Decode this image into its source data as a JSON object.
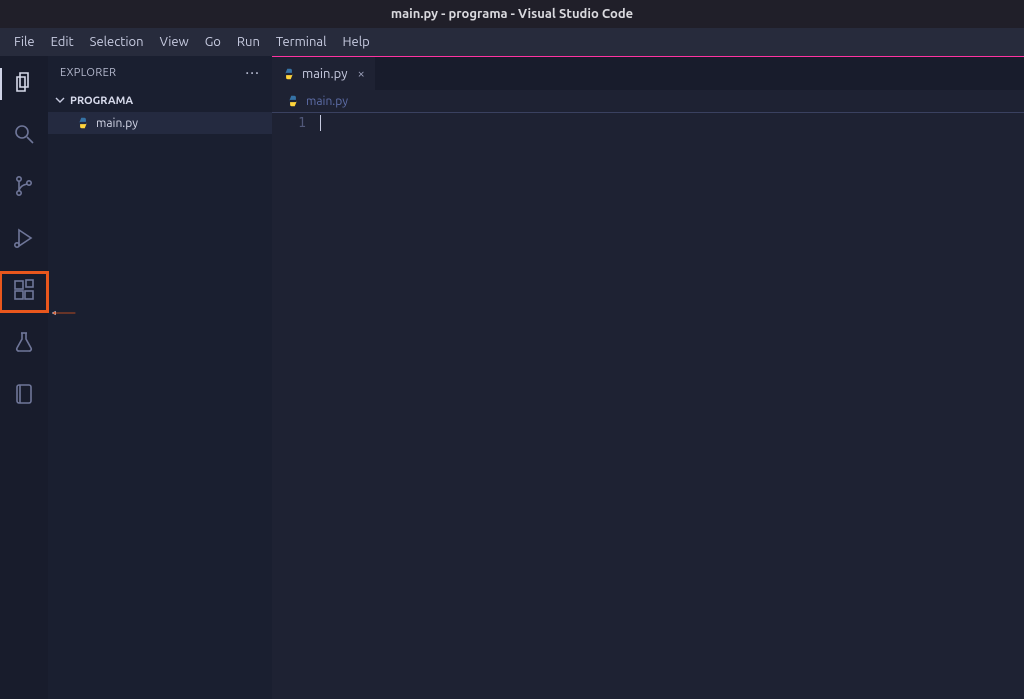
{
  "window": {
    "title": "main.py - programa - Visual Studio Code"
  },
  "menu": {
    "file": "File",
    "edit": "Edit",
    "selection": "Selection",
    "view": "View",
    "go": "Go",
    "run": "Run",
    "terminal": "Terminal",
    "help": "Help"
  },
  "activity": {
    "items": [
      {
        "name": "explorer",
        "active": true,
        "highlighted": false
      },
      {
        "name": "search",
        "active": false,
        "highlighted": false
      },
      {
        "name": "scm",
        "active": false,
        "highlighted": false
      },
      {
        "name": "run-debug",
        "active": false,
        "highlighted": false
      },
      {
        "name": "extensions",
        "active": false,
        "highlighted": true
      },
      {
        "name": "testing",
        "active": false,
        "highlighted": false
      },
      {
        "name": "notebook",
        "active": false,
        "highlighted": false
      }
    ]
  },
  "explorer": {
    "title": "EXPLORER",
    "more": "···",
    "folder": {
      "name": "PROGRAMA",
      "expanded": true
    },
    "files": [
      {
        "name": "main.py",
        "icon": "python-icon"
      }
    ]
  },
  "tabs": {
    "items": [
      {
        "label": "main.py",
        "icon": "python-icon",
        "close": "×",
        "active": true
      }
    ]
  },
  "breadcrumb": {
    "segments": [
      {
        "label": "main.py",
        "icon": "python-icon"
      }
    ]
  },
  "editor": {
    "lineNumbers": [
      "1"
    ],
    "lines": [
      ""
    ]
  },
  "annotation": {
    "arrow_target": "extensions",
    "color": "#e9571d"
  }
}
